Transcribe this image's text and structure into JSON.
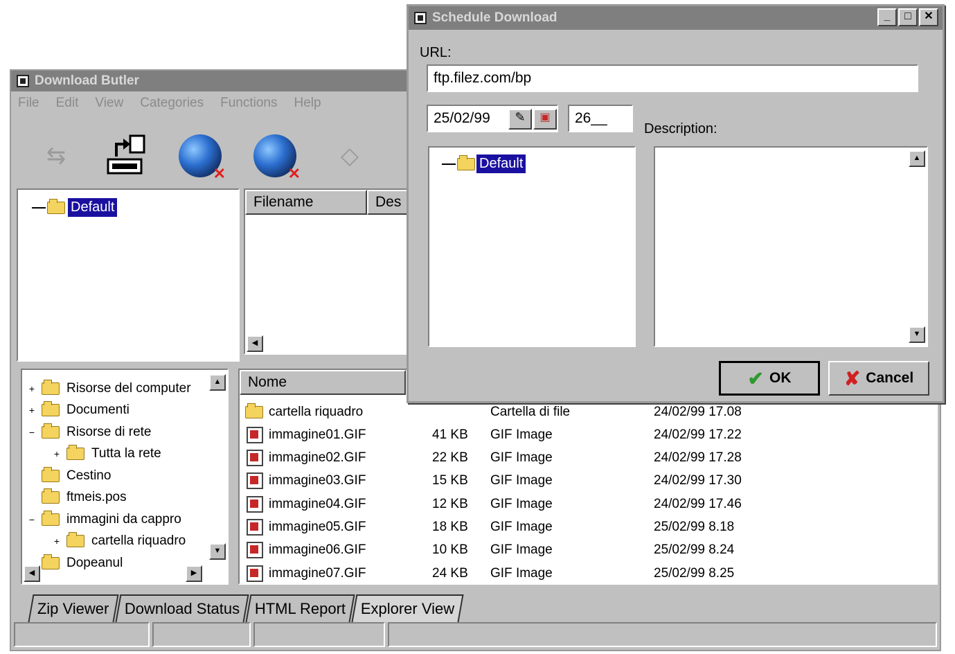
{
  "main_window": {
    "title": "Download Butler",
    "menu": [
      "File",
      "Edit",
      "View",
      "Categories",
      "Functions",
      "Help"
    ]
  },
  "category_tree": {
    "root": "Default"
  },
  "file_list": {
    "columns": [
      "Filename",
      "Des"
    ]
  },
  "explorer_tree": {
    "items": [
      {
        "expander": "+",
        "label": "Risorse del computer"
      },
      {
        "expander": "+",
        "label": "Documenti"
      },
      {
        "expander": "−",
        "label": "Risorse di rete"
      },
      {
        "expander": "+",
        "label": "Tutta la rete"
      },
      {
        "expander": "",
        "label": "Cestino"
      },
      {
        "expander": "",
        "label": "ftmeis.pos"
      },
      {
        "expander": "−",
        "label": "immagini da cappro"
      },
      {
        "expander": "+",
        "label": "cartella riquadro"
      },
      {
        "expander": "",
        "label": "Dopeanul"
      }
    ]
  },
  "explorer_list": {
    "header": "Nome",
    "rows": [
      {
        "icon": "folder",
        "name": "cartella riquadro",
        "size": "",
        "type": "Cartella di file",
        "date": "24/02/99 17.08"
      },
      {
        "icon": "gif",
        "name": "immagine01.GIF",
        "size": "41 KB",
        "type": "GIF Image",
        "date": "24/02/99 17.22"
      },
      {
        "icon": "gif",
        "name": "immagine02.GIF",
        "size": "22 KB",
        "type": "GIF Image",
        "date": "24/02/99 17.28"
      },
      {
        "icon": "gif",
        "name": "immagine03.GIF",
        "size": "15 KB",
        "type": "GIF Image",
        "date": "24/02/99 17.30"
      },
      {
        "icon": "gif",
        "name": "immagine04.GIF",
        "size": "12 KB",
        "type": "GIF Image",
        "date": "24/02/99 17.46"
      },
      {
        "icon": "gif",
        "name": "immagine05.GIF",
        "size": "18 KB",
        "type": "GIF Image",
        "date": "25/02/99 8.18"
      },
      {
        "icon": "gif",
        "name": "immagine06.GIF",
        "size": "10 KB",
        "type": "GIF Image",
        "date": "25/02/99 8.24"
      },
      {
        "icon": "gif",
        "name": "immagine07.GIF",
        "size": "24 KB",
        "type": "GIF Image",
        "date": "25/02/99 8.25"
      }
    ]
  },
  "tabs": [
    {
      "label": "Zip Viewer",
      "active": false
    },
    {
      "label": "Download Status",
      "active": false
    },
    {
      "label": "HTML Report",
      "active": false
    },
    {
      "label": "Explorer View",
      "active": true
    }
  ],
  "dialog": {
    "title": "Schedule Download",
    "url_label": "URL:",
    "url_value": "ftp.filez.com/bp",
    "date_value": "25/02/99",
    "time_value": "26__",
    "description_label": "Description:",
    "tree_root": "Default",
    "ok_label": "OK",
    "cancel_label": "Cancel"
  }
}
